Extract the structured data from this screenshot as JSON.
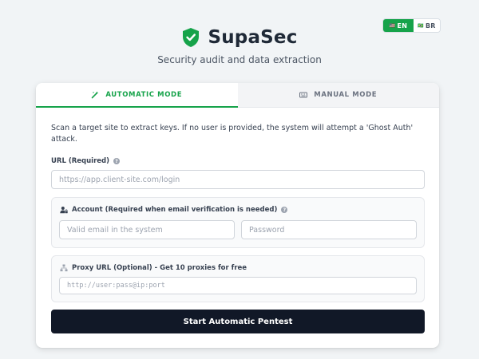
{
  "language": {
    "options": [
      {
        "flag": "🇺🇸",
        "code": "EN",
        "active": true
      },
      {
        "flag": "🇧🇷",
        "code": "BR",
        "active": false
      }
    ]
  },
  "header": {
    "title": "SupaSec",
    "subtitle": "Security audit and data extraction",
    "logo_icon": "shield-check-icon"
  },
  "tabs": [
    {
      "label": "AUTOMATIC MODE",
      "icon": "magic-wand-icon",
      "active": true
    },
    {
      "label": "MANUAL MODE",
      "icon": "keyboard-icon",
      "active": false
    }
  ],
  "form": {
    "description": "Scan a target site to extract keys. If no user is provided, the system will attempt a 'Ghost Auth' attack.",
    "url": {
      "label": "URL (Required)",
      "placeholder": "https://app.client-site.com/login",
      "value": ""
    },
    "account": {
      "label": "Account (Required when email verification is needed)",
      "email_placeholder": "Valid email in the system",
      "password_placeholder": "Password"
    },
    "proxy": {
      "label": "Proxy URL (Optional) - Get 10 proxies for free",
      "placeholder": "http://user:pass@ip:port"
    },
    "submit_label": "Start Automatic Pentest"
  },
  "colors": {
    "accent": "#16a34a",
    "button": "#111827",
    "background": "#f1f4f6"
  }
}
